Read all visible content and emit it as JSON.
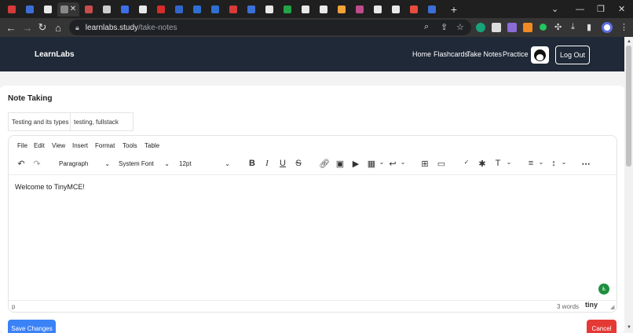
{
  "browser": {
    "tabs": [
      {
        "color": "#d63a3a"
      },
      {
        "color": "#3b6fd6"
      },
      {
        "color": "#e8e8e8"
      },
      {
        "color": "#888888",
        "active": true
      },
      {
        "color": "#c94c4c"
      },
      {
        "color": "#cccccc"
      },
      {
        "color": "#3d6ee8"
      },
      {
        "color": "#e8e8e8"
      },
      {
        "color": "#d62c2c"
      },
      {
        "color": "#3366cc"
      },
      {
        "color": "#2f6fd1"
      },
      {
        "color": "#2f6fd1"
      },
      {
        "color": "#d63a3a"
      },
      {
        "color": "#3b6fd6"
      },
      {
        "color": "#e8e8e8"
      },
      {
        "color": "#22a447"
      },
      {
        "color": "#e8e8e8"
      },
      {
        "color": "#e8e8e8"
      },
      {
        "color": "#f2a33a"
      },
      {
        "color": "#c04b8b"
      },
      {
        "color": "#e8e8e8"
      },
      {
        "color": "#e8e8e8"
      },
      {
        "color": "#e74c3c"
      },
      {
        "color": "#3b6fd6"
      }
    ],
    "address_host": "learnlabs.study",
    "address_path": "/take-notes"
  },
  "site": {
    "brand": "LearnLabs",
    "nav": {
      "home": "Home",
      "flashcards": "Flashcards",
      "take_notes": "Take Notes",
      "practice": "Practice",
      "logout": "Log Out"
    }
  },
  "page": {
    "title": "Note Taking",
    "note_title_value": "Testing and its types",
    "tags_value": "testing, fullstack"
  },
  "editor": {
    "menu": [
      "File",
      "Edit",
      "View",
      "Insert",
      "Format",
      "Tools",
      "Table"
    ],
    "block_format": "Paragraph",
    "font_family": "System Font",
    "font_size": "12pt",
    "content": "Welcome to TinyMCE!",
    "path": "p",
    "word_count": "3 words",
    "brand": "tiny"
  },
  "actions": {
    "save": "Save Changes",
    "cancel": "Cancel"
  },
  "colors": {
    "nav_bg": "#1f2937",
    "primary": "#3b82f6",
    "danger": "#e53935"
  }
}
